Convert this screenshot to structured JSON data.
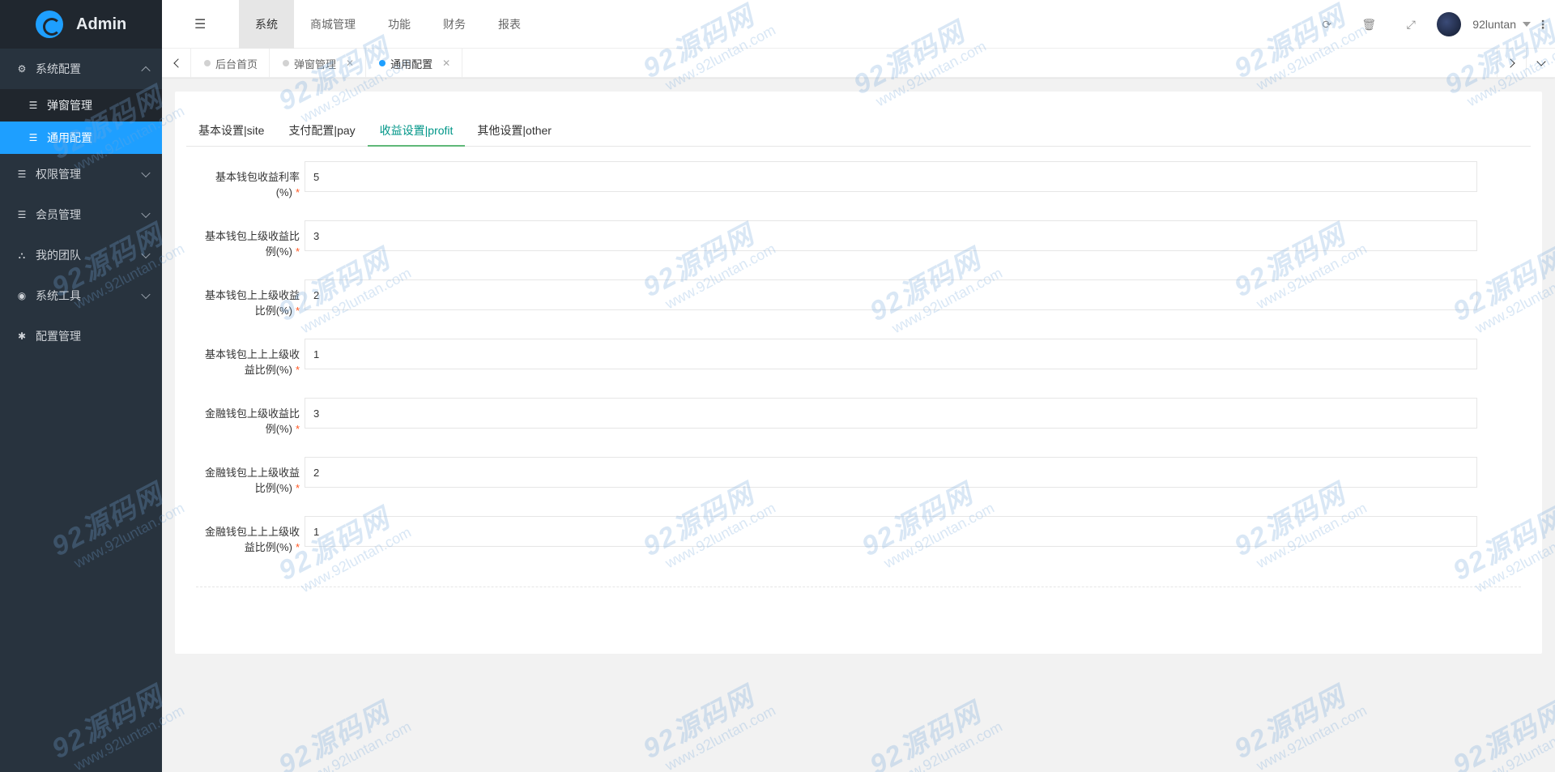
{
  "brand": {
    "title": "Admin"
  },
  "sidebar": {
    "menus": [
      {
        "label": "系统配置",
        "icon": "gears-icon",
        "expanded": true,
        "children": [
          {
            "label": "弹窗管理",
            "active": false
          },
          {
            "label": "通用配置",
            "active": true
          }
        ]
      },
      {
        "label": "权限管理",
        "icon": "list-icon"
      },
      {
        "label": "会员管理",
        "icon": "list-icon"
      },
      {
        "label": "我的团队",
        "icon": "sitemap-icon"
      },
      {
        "label": "系统工具",
        "icon": "compass-icon"
      },
      {
        "label": "配置管理",
        "icon": "asterisk-icon"
      }
    ]
  },
  "header": {
    "nav": [
      "系统",
      "商城管理",
      "功能",
      "财务",
      "报表"
    ],
    "active_nav": "系统",
    "user": "92luntan"
  },
  "page_tabs": [
    {
      "label": "后台首页",
      "closable": false
    },
    {
      "label": "弹窗管理",
      "closable": true
    },
    {
      "label": "通用配置",
      "closable": true,
      "active": true
    }
  ],
  "form": {
    "tabs": [
      "基本设置|site",
      "支付配置|pay",
      "收益设置|profit",
      "其他设置|other"
    ],
    "active_tab": "收益设置|profit",
    "fields": [
      {
        "label": "基本钱包收益利率(%)",
        "value": "5"
      },
      {
        "label": "基本钱包上级收益比例(%)",
        "value": "3"
      },
      {
        "label": "基本钱包上上级收益比例(%)",
        "value": "2"
      },
      {
        "label": "基本钱包上上上级收益比例(%)",
        "value": "1"
      },
      {
        "label": "金融钱包上级收益比例(%)",
        "value": "3"
      },
      {
        "label": "金融钱包上上级收益比例(%)",
        "value": "2"
      },
      {
        "label": "金融钱包上上上级收益比例(%)",
        "value": "1"
      }
    ]
  },
  "watermark": {
    "line1": "92源码网",
    "line2": "www.92luntan.com"
  },
  "colors": {
    "sidebar_bg": "#28333e",
    "active_blue": "#1e9fff",
    "tab_active": "#009688",
    "required": "#ff5722"
  }
}
